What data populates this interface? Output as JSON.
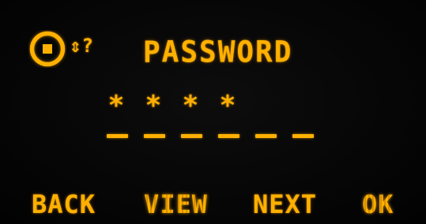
{
  "display": {
    "accent_color": "#ffb000",
    "background_color": "#050505"
  },
  "header": {
    "icon": "lock-dial-icon",
    "status_glyph": "⇕?",
    "title": "PASSWORD"
  },
  "password": {
    "entered": [
      "*",
      "*",
      "*",
      "*"
    ],
    "slot_count": 6
  },
  "softkeys": {
    "back": "BACK",
    "view": "VIEW",
    "next": "NEXT",
    "ok": "OK"
  }
}
